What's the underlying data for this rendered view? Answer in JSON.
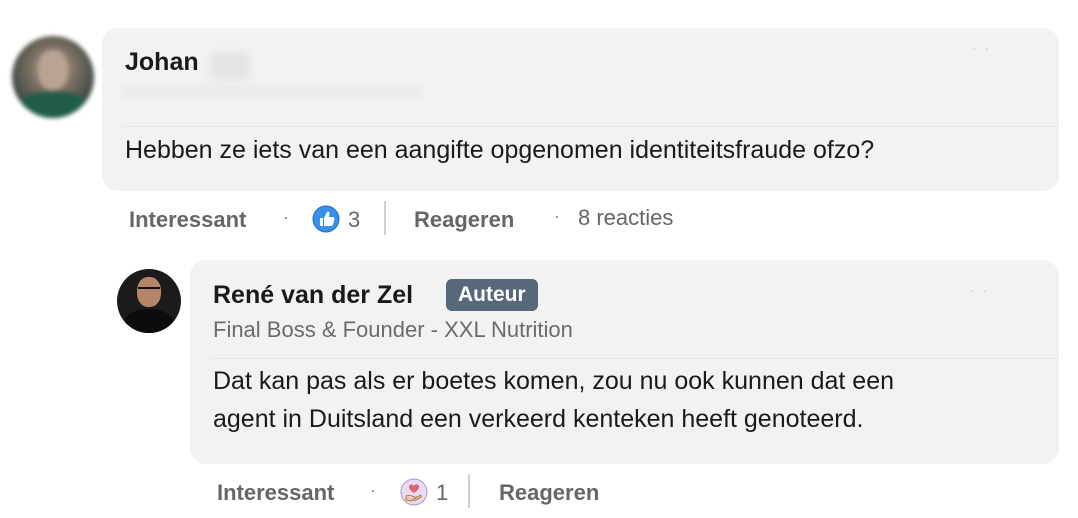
{
  "comment": {
    "author": "Johan",
    "text": "Hebben ze iets van een aangifte opgenomen identiteitsfraude ofzo?",
    "actions": {
      "like_label": "Interessant",
      "reaction_icon": "thumbs-up-icon",
      "reaction_count": "3",
      "reply_label": "Reageren",
      "replies_count": "8 reacties"
    }
  },
  "reply": {
    "author": "René van der Zel",
    "badge": "Auteur",
    "headline": "Final Boss & Founder - XXL Nutrition",
    "text_line1": "Dat kan pas als er boetes komen, zou nu ook kunnen dat een",
    "text_line2": "agent in Duitsland een verkeerd kenteken heeft genoteerd.",
    "actions": {
      "like_label": "Interessant",
      "reaction_icon": "heart-hand-icon",
      "reaction_count": "1",
      "reply_label": "Reageren"
    }
  },
  "colors": {
    "bubble_bg": "#f2f2f2",
    "badge_bg": "#56687a",
    "like_blue": "#378fe9",
    "support_purple": "#c6a3d6"
  }
}
